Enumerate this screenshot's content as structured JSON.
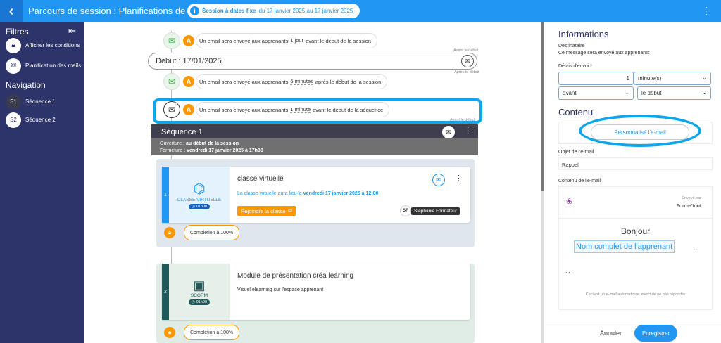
{
  "header": {
    "title": "Parcours de session : Planifications de mails",
    "session_pill": "Session à dates fixe",
    "session_pill_dates": "du 17 janvier 2025 au 17 janvier 2025"
  },
  "sidebar": {
    "filters_heading": "Filtres",
    "filter_items": [
      {
        "label": "Afficher les conditions",
        "icon": "lock-icon"
      },
      {
        "label": "Planification des mails",
        "icon": "mail-icon"
      }
    ],
    "navigation_heading": "Navigation",
    "nav_items": [
      {
        "badge": "S1",
        "label": "Séquence 1"
      },
      {
        "badge": "S2",
        "label": "Séquence 2"
      }
    ]
  },
  "timeline": {
    "notif1": {
      "prefix": "Un email sera envoyé aux apprenants",
      "delay": "1 jour",
      "suffix": "avant le début de la session"
    },
    "avant_debut": "Avant le début",
    "debut_label": "Début : 17/01/2025",
    "apres_debut": "Après le début",
    "notif2": {
      "prefix": "Un email sera envoyé aux apprenants",
      "delay": "5 minutes",
      "suffix": "après le début de la session"
    },
    "notif3": {
      "prefix": "Un email sera envoyé aux apprenants",
      "delay": "1 minute",
      "suffix": "avant le début de la séquence"
    },
    "avant_debut2": "Avant le début",
    "sequence": {
      "title": "Séquence 1",
      "ouverture_label": "Ouverture :",
      "ouverture_value": "au début de la session",
      "fermeture_label": "Fermeture :",
      "fermeture_value": "vendredi 17 janvier 2025 à 17h00"
    },
    "module1": {
      "number": "1",
      "type": "CLASSE VIRTUELLE",
      "duration": "01h00",
      "title": "classe virtuelle",
      "desc_prefix": "La classe virtuelle aura lieu le",
      "desc_date": "vendredi 17 janvier 2025 à 12:00",
      "join_button": "Rejoindre la classe",
      "trainer_initials": "SF",
      "trainer_name": "Stephanie Formateur"
    },
    "completion1": "Complétion à 100%",
    "module2": {
      "number": "2",
      "type": "SCORM",
      "duration": "01h00",
      "title": "Module de présentation créa learning",
      "desc": "Visuel elearning sur l'espace apprenant"
    },
    "completion2": "Complétion à 100%"
  },
  "info_panel": {
    "title": "Informations",
    "destinataire_label": "Destinataire",
    "destinataire_desc": "Ce message sera envoyé aux apprenants",
    "delai_label": "Délais d'envoi *",
    "delai_value": "1",
    "delai_unit": "minute(s)",
    "position": "avant",
    "reference": "le début",
    "contenu_title": "Contenu",
    "personalize_button": "Personnalisé l'e-mail",
    "objet_label": "Objet de l'e-mail",
    "objet_value": "Rappel",
    "contenu_label": "Contenu de l'e-mail",
    "preview": {
      "envoye_par": "Envoyé par",
      "sender": "Forma'tout",
      "greeting": "Bonjour",
      "name_tag": "Nom complet de l'apprenant",
      "ellipsis": "...",
      "footer_note": "Ceci est un e-mail automatique, merci de ne pas répondre"
    },
    "cancel_button": "Annuler",
    "save_button": "Enregistrer"
  },
  "colors": {
    "primary": "#2196f3",
    "sidebar": "#2c3469",
    "highlight": "#0ea5e9",
    "orange": "#ff9800",
    "green": "#4caf50"
  }
}
